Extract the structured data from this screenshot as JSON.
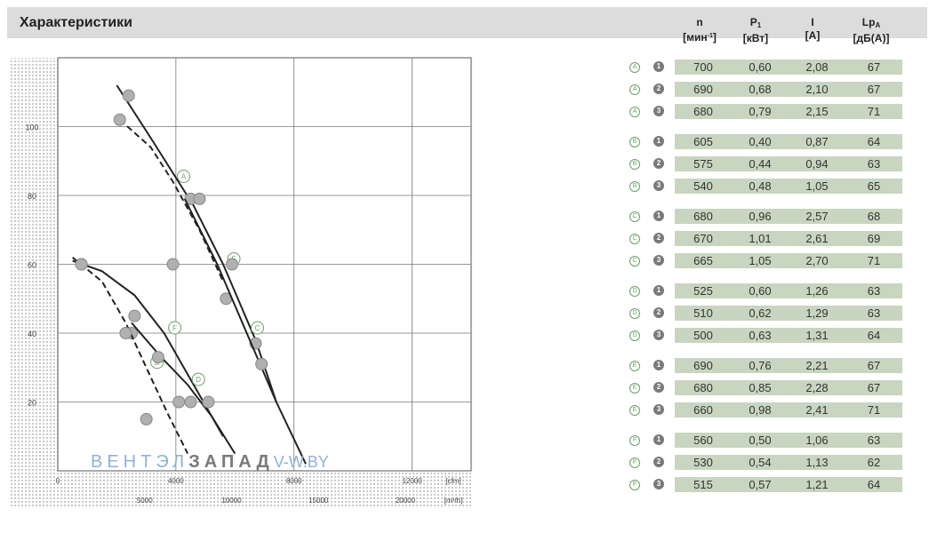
{
  "page": {
    "title": "Характеристики"
  },
  "table": {
    "headers": [
      {
        "symbol": "n",
        "sub": "",
        "unit_pre": "[мин",
        "unit_sup": "-1",
        "unit_post": "]"
      },
      {
        "symbol": "P",
        "sub": "1",
        "unit_pre": "[кВт]",
        "unit_sup": "",
        "unit_post": ""
      },
      {
        "symbol": "I",
        "sub": "",
        "unit_pre": "[A]",
        "unit_sup": "",
        "unit_post": ""
      },
      {
        "symbol": "Lp",
        "sub": "A",
        "unit_pre": "[дБ(A)]",
        "unit_sup": "",
        "unit_post": ""
      }
    ],
    "rows": [
      {
        "curve": "A",
        "point": "1",
        "n": "700",
        "p1": "0,60",
        "i": "2,08",
        "lp": "67"
      },
      {
        "curve": "A",
        "point": "2",
        "n": "690",
        "p1": "0,68",
        "i": "2,10",
        "lp": "67"
      },
      {
        "curve": "A",
        "point": "3",
        "n": "680",
        "p1": "0,79",
        "i": "2,15",
        "lp": "71"
      },
      {
        "curve": "B",
        "point": "1",
        "n": "605",
        "p1": "0,40",
        "i": "0,87",
        "lp": "64"
      },
      {
        "curve": "B",
        "point": "2",
        "n": "575",
        "p1": "0,44",
        "i": "0,94",
        "lp": "63"
      },
      {
        "curve": "B",
        "point": "3",
        "n": "540",
        "p1": "0,48",
        "i": "1,05",
        "lp": "65"
      },
      {
        "curve": "C",
        "point": "1",
        "n": "680",
        "p1": "0,96",
        "i": "2,57",
        "lp": "68"
      },
      {
        "curve": "C",
        "point": "2",
        "n": "670",
        "p1": "1,01",
        "i": "2,61",
        "lp": "69"
      },
      {
        "curve": "C",
        "point": "3",
        "n": "665",
        "p1": "1,05",
        "i": "2,70",
        "lp": "71"
      },
      {
        "curve": "D",
        "point": "1",
        "n": "525",
        "p1": "0,60",
        "i": "1,26",
        "lp": "63"
      },
      {
        "curve": "D",
        "point": "2",
        "n": "510",
        "p1": "0,62",
        "i": "1,29",
        "lp": "63"
      },
      {
        "curve": "D",
        "point": "3",
        "n": "500",
        "p1": "0,63",
        "i": "1,31",
        "lp": "64"
      },
      {
        "curve": "E",
        "point": "1",
        "n": "690",
        "p1": "0,76",
        "i": "2,21",
        "lp": "67"
      },
      {
        "curve": "E",
        "point": "2",
        "n": "680",
        "p1": "0,85",
        "i": "2,28",
        "lp": "67"
      },
      {
        "curve": "E",
        "point": "3",
        "n": "660",
        "p1": "0,98",
        "i": "2,41",
        "lp": "71"
      },
      {
        "curve": "F",
        "point": "1",
        "n": "560",
        "p1": "0,50",
        "i": "1,06",
        "lp": "63"
      },
      {
        "curve": "F",
        "point": "2",
        "n": "530",
        "p1": "0,54",
        "i": "1,13",
        "lp": "62"
      },
      {
        "curve": "F",
        "point": "3",
        "n": "515",
        "p1": "0,57",
        "i": "1,21",
        "lp": "64"
      }
    ]
  },
  "watermark": {
    "part1": "ВЕНТЭЛ",
    "part2": "ЗАПАД",
    "part3": "V-W.BY"
  },
  "chart_data": {
    "type": "line",
    "title": "",
    "xlabel": "[cfm]",
    "ylabel": "",
    "x_ticks": [
      "0",
      "4000",
      "8000",
      "12000"
    ],
    "x_secondary_unit": "[m³/h]",
    "x_secondary_ticks": [
      "5000",
      "10000",
      "15000",
      "20000"
    ],
    "y_ticks": [
      "20",
      "40",
      "60",
      "80",
      "100"
    ],
    "xlim": [
      0,
      14000
    ],
    "ylim": [
      0,
      120
    ],
    "grid": true,
    "series": [
      {
        "name": "A",
        "dash": true,
        "x": [
          2100,
          3150,
          3900,
          4800,
          5600
        ],
        "y": [
          102,
          94,
          84,
          70,
          55
        ],
        "points_x": [
          2100,
          3900
        ],
        "points_y": [
          102,
          60
        ]
      },
      {
        "name": "E",
        "dash": false,
        "x": [
          2000,
          3200,
          4600,
          5600,
          6700,
          7400
        ],
        "y": [
          112,
          96,
          77,
          60,
          38,
          20
        ],
        "points_x": [
          2400,
          4500,
          4800,
          5700,
          6700
        ],
        "points_y": [
          109,
          79,
          79,
          50,
          37
        ]
      },
      {
        "name": "C",
        "dash": false,
        "x": [
          4300,
          5400,
          6400,
          7400,
          8400
        ],
        "y": [
          79,
          60,
          40,
          20,
          2
        ],
        "points_x": [
          5900,
          6900
        ],
        "points_y": [
          60,
          31
        ]
      },
      {
        "name": "F",
        "dash": false,
        "x": [
          500,
          1500,
          2600,
          3600,
          4600,
          5600
        ],
        "y": [
          61,
          58,
          51,
          40,
          25,
          10
        ],
        "points_x": [
          800,
          2600,
          2500
        ],
        "points_y": [
          60,
          45,
          40
        ]
      },
      {
        "name": "B",
        "dash": true,
        "x": [
          500,
          1500,
          2300,
          3000,
          3700,
          4400
        ],
        "y": [
          62,
          55,
          43,
          30,
          17,
          5
        ],
        "points_x": [
          800,
          2300,
          3000
        ],
        "points_y": [
          60,
          40,
          15
        ]
      },
      {
        "name": "D",
        "dash": false,
        "x": [
          2500,
          3500,
          4400,
          5200,
          6000
        ],
        "y": [
          43,
          33,
          25,
          16,
          5
        ],
        "points_x": [
          3400,
          4100,
          4500,
          5100
        ],
        "points_y": [
          33,
          20,
          20,
          20
        ]
      }
    ]
  }
}
